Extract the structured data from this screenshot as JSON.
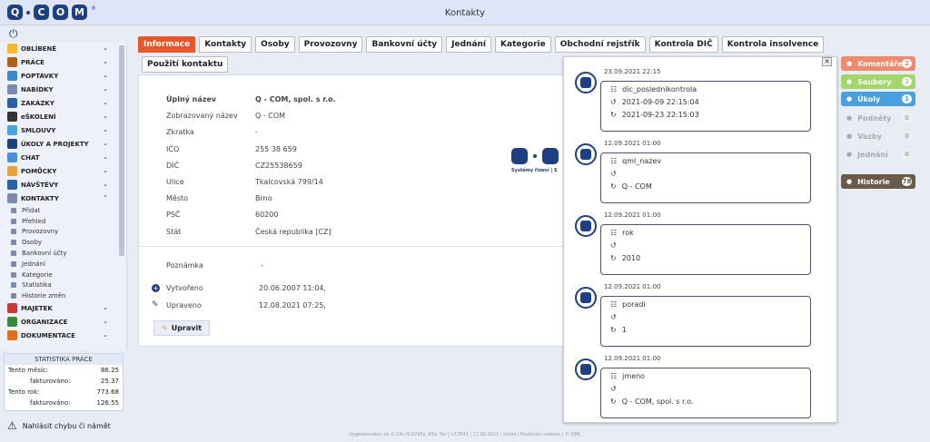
{
  "header": {
    "title": "Kontakty",
    "logo": "Q·COM"
  },
  "sidebar": {
    "menu": [
      {
        "label": "OBLÍBENÉ",
        "color": "#f3b92b"
      },
      {
        "label": "PRÁCE",
        "color": "#b0621a"
      },
      {
        "label": "POPTÁVKY",
        "color": "#3a89c9"
      },
      {
        "label": "NABÍDKY",
        "color": "#7b8bb0"
      },
      {
        "label": "ZAKÁZKY",
        "color": "#2b5fa8"
      },
      {
        "label": "eŠKOLENÍ",
        "color": "#333333"
      },
      {
        "label": "SMLOUVY",
        "color": "#4aa3df"
      },
      {
        "label": "ÚKOLY A PROJEKTY",
        "color": "#1e3f80"
      },
      {
        "label": "CHAT",
        "color": "#4a90d9"
      },
      {
        "label": "POMŮCKY",
        "color": "#e8a33c"
      },
      {
        "label": "NÁVŠTĚVY",
        "color": "#2b5fa8"
      },
      {
        "label": "KONTAKTY",
        "color": "#7b8bb0"
      }
    ],
    "submenu": [
      "Přidat",
      "Přehled",
      "Provozovny",
      "Osoby",
      "Bankovní účty",
      "Jednání",
      "Kategorie",
      "Statistika",
      "Historie změn"
    ],
    "menu2": [
      {
        "label": "MAJETEK",
        "color": "#c83a3a"
      },
      {
        "label": "ORGANIZACE",
        "color": "#3b8a3b"
      },
      {
        "label": "DOKUMENTACE",
        "color": "#e07020"
      }
    ],
    "stats": {
      "title": "STATISTIKA PRÁCE",
      "rows": [
        {
          "label": "Tento měsíc:",
          "value": "86.25",
          "indent": false
        },
        {
          "label": "fakturováno:",
          "value": "25.37",
          "indent": true
        },
        {
          "label": "Tento rok:",
          "value": "773.68",
          "indent": false
        },
        {
          "label": "fakturováno:",
          "value": "126.55",
          "indent": true
        }
      ]
    },
    "report": "Nahlásit chybu či námět"
  },
  "tabs": [
    "Informace",
    "Kontakty",
    "Osoby",
    "Provozovny",
    "Bankovní účty",
    "Jednání",
    "Kategorie",
    "Obchodní rejstřík",
    "Kontrola DIČ",
    "Kontrola insolvence"
  ],
  "tab2": "Použití kontaktu",
  "detail": {
    "fields": [
      {
        "label": "Úplný název",
        "value": "Q - COM, spol. s r.o."
      },
      {
        "label": "Zobrazovaný název",
        "value": "Q - COM"
      },
      {
        "label": "Zkratka",
        "value": "-"
      },
      {
        "label": "IČO",
        "value": "255 38 659"
      },
      {
        "label": "DIČ",
        "value": "CZ25538659"
      },
      {
        "label": "Ulice",
        "value": "Tkalcovská 799/14"
      },
      {
        "label": "Město",
        "value": "Brno"
      },
      {
        "label": "PSČ",
        "value": "60200"
      },
      {
        "label": "Stát",
        "value": "Česká republika [CZ]"
      }
    ],
    "note_label": "Poznámka",
    "note_value": "-",
    "created_label": "Vytvořeno",
    "created_value": "20.06.2007 11:04,",
    "updated_label": "Upraveno",
    "updated_value": "12.08.2021 07:25,",
    "edit_button": "Upravit",
    "logo_sub": "Systémy řízení | S"
  },
  "history": [
    {
      "date": "23.09.2021 22:15",
      "field": "dic_poslednikontrola",
      "old": "2021-09-09 22:15:04",
      "new": "2021-09-23 22:15:03"
    },
    {
      "date": "12.09.2021 01:00",
      "field": "qml_nazev",
      "old": "",
      "new": "Q - COM"
    },
    {
      "date": "12.09.2021 01:00",
      "field": "rok",
      "old": "",
      "new": "2010"
    },
    {
      "date": "12.09.2021 01:00",
      "field": "poradi",
      "old": "",
      "new": "1"
    },
    {
      "date": "12.09.2021 01:00",
      "field": "jmeno",
      "old": "",
      "new": "Q - COM, spol. s r.o."
    }
  ],
  "right": [
    {
      "label": "Komentáře",
      "count": "2",
      "color": "#f08a6c",
      "gray": false
    },
    {
      "label": "Soubory",
      "count": "2",
      "color": "#a5d66b",
      "gray": false
    },
    {
      "label": "Úkoly",
      "count": "1",
      "color": "#4a9fe0",
      "gray": false
    },
    {
      "label": "Podněty",
      "count": "0",
      "color": "",
      "gray": true
    },
    {
      "label": "Vazby",
      "count": "0",
      "color": "",
      "gray": true
    },
    {
      "label": "Jednání",
      "count": "0",
      "color": "",
      "gray": true
    },
    {
      "label": "Historie",
      "count": "78",
      "color": "#6b5a4a",
      "gray": false
    }
  ],
  "footer": "Vygenerováno za: 0.13s (0.0295s, 83x, 0x) | v13543 | 17.09.2021 | orejní | Používání cookies | © QML"
}
